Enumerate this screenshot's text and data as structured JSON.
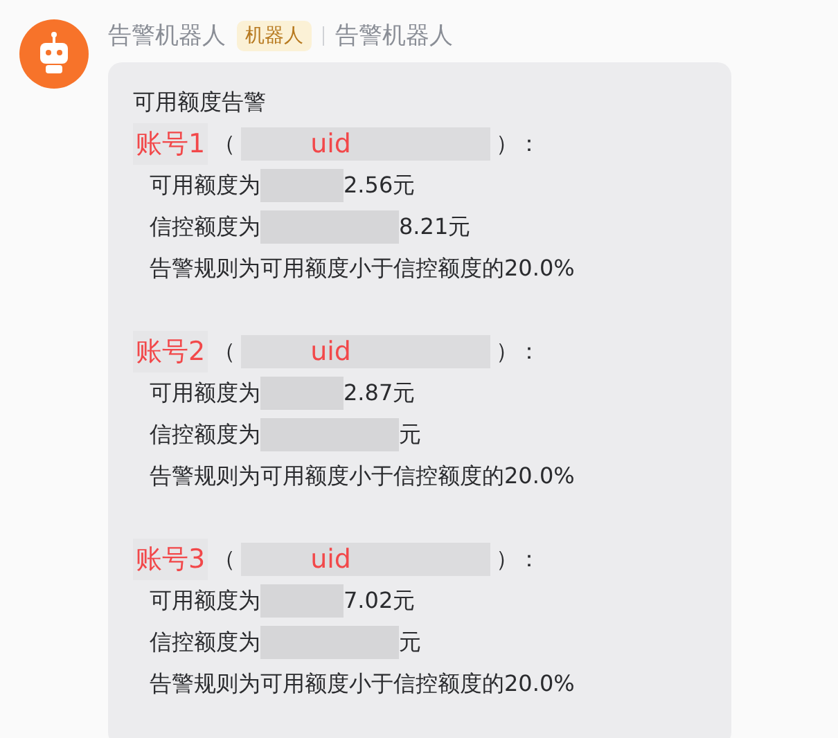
{
  "sender": {
    "name": "告警机器人",
    "badge": "机器人",
    "group": "告警机器人"
  },
  "message": {
    "title": "可用额度告警",
    "accounts": [
      {
        "label": "账号1",
        "open": "（",
        "uid": "uid",
        "close": "）：",
        "lines": [
          {
            "kind": "redacted",
            "prefix": "可用额度为",
            "suffix": "2.56元"
          },
          {
            "kind": "redacted",
            "prefix": "信控额度为",
            "suffix": "8.21元"
          },
          {
            "kind": "plain",
            "text": "告警规则为可用额度小于信控额度的20.0%"
          }
        ]
      },
      {
        "label": "账号2",
        "open": "（",
        "uid": "uid",
        "close": "）：",
        "lines": [
          {
            "kind": "redacted",
            "prefix": "可用额度为",
            "suffix": "2.87元"
          },
          {
            "kind": "redacted",
            "prefix": "信控额度为",
            "suffix": "元"
          },
          {
            "kind": "plain",
            "text": "告警规则为可用额度小于信控额度的20.0%"
          }
        ]
      },
      {
        "label": "账号3",
        "open": "（",
        "uid": "uid",
        "close": "）：",
        "lines": [
          {
            "kind": "redacted",
            "prefix": "可用额度为",
            "suffix": "7.02元"
          },
          {
            "kind": "redacted",
            "prefix": "信控额度为",
            "suffix": "元"
          },
          {
            "kind": "plain",
            "text": "告警规则为可用额度小于信控额度的20.0%"
          }
        ]
      }
    ]
  }
}
